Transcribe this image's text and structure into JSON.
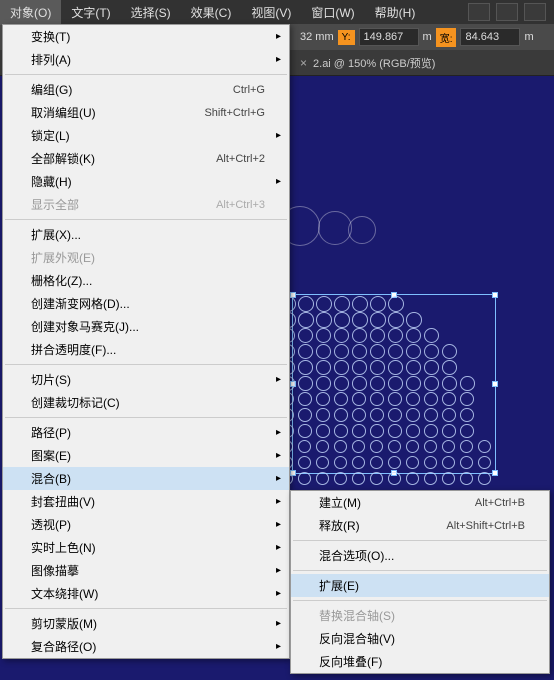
{
  "menubar": {
    "items": [
      "对象(O)",
      "文字(T)",
      "选择(S)",
      "效果(C)",
      "视图(V)",
      "窗口(W)",
      "帮助(H)"
    ]
  },
  "controlbar": {
    "x_unit": "32 mm",
    "y_label": "Y:",
    "y_value": "149.867",
    "w_label": "宽:",
    "w_value": "84.643",
    "unit": "m"
  },
  "tab": {
    "label": "2.ai @ 150% (RGB/预览)",
    "close": "×"
  },
  "menu": {
    "transform": "变换(T)",
    "arrange": "排列(A)",
    "group": "编组(G)",
    "group_sc": "Ctrl+G",
    "ungroup": "取消编组(U)",
    "ungroup_sc": "Shift+Ctrl+G",
    "lock": "锁定(L)",
    "unlockall": "全部解锁(K)",
    "unlockall_sc": "Alt+Ctrl+2",
    "hide": "隐藏(H)",
    "showall": "显示全部",
    "showall_sc": "Alt+Ctrl+3",
    "expand": "扩展(X)...",
    "expandapp": "扩展外观(E)",
    "rasterize": "栅格化(Z)...",
    "gradientmesh": "创建渐变网格(D)...",
    "mosaic": "创建对象马赛克(J)...",
    "flatten": "拼合透明度(F)...",
    "slice": "切片(S)",
    "trimmarks": "创建裁切标记(C)",
    "path": "路径(P)",
    "pattern": "图案(E)",
    "blend": "混合(B)",
    "envelope": "封套扭曲(V)",
    "perspective": "透视(P)",
    "livepaint": "实时上色(N)",
    "imagetrace": "图像描摹",
    "textwrap": "文本绕排(W)",
    "clipmask": "剪切蒙版(M)",
    "compound": "复合路径(O)"
  },
  "submenu": {
    "make": "建立(M)",
    "make_sc": "Alt+Ctrl+B",
    "release": "释放(R)",
    "release_sc": "Alt+Shift+Ctrl+B",
    "options": "混合选项(O)...",
    "expand": "扩展(E)",
    "replacespine": "替换混合轴(S)",
    "reversespine": "反向混合轴(V)",
    "reversefront": "反向堆叠(F)"
  }
}
